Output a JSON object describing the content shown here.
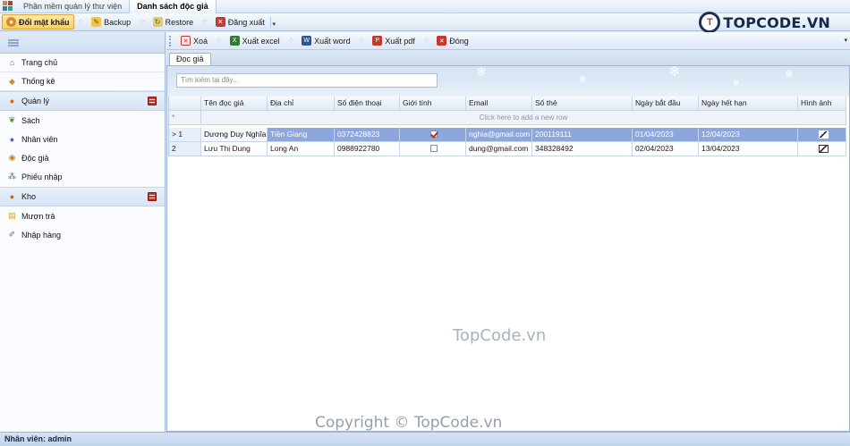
{
  "titlebar": {
    "tabs": [
      {
        "label": "Phần mềm quản lý thư viện",
        "active": false
      },
      {
        "label": "Danh sách độc giả",
        "active": true
      }
    ]
  },
  "toolbar": {
    "items": [
      {
        "label": "Đổi mật khẩu",
        "icon": "key-user-icon",
        "pressed": true
      },
      {
        "label": "Backup",
        "icon": "backup-icon"
      },
      {
        "label": "Restore",
        "icon": "restore-icon"
      },
      {
        "label": "Đăng xuất",
        "icon": "logout-icon"
      }
    ]
  },
  "logo": {
    "mark": "T",
    "text": "TOPCODE.VN"
  },
  "sidebar": {
    "items": [
      {
        "label": "Trang chủ",
        "icon": "home-icon",
        "group": false
      },
      {
        "label": "Thống kê",
        "icon": "chart-icon",
        "group": false
      },
      {
        "label": "Quản lý",
        "icon": "manage-icon",
        "group": true
      },
      {
        "label": "Sách",
        "icon": "book-icon",
        "group": false
      },
      {
        "label": "Nhân viên",
        "icon": "employee-icon",
        "group": false
      },
      {
        "label": "Độc giả",
        "icon": "reader-icon",
        "group": false
      },
      {
        "label": "Phiếu nhập",
        "icon": "receipt-icon",
        "group": false
      },
      {
        "label": "Kho",
        "icon": "warehouse-icon",
        "group": true
      },
      {
        "label": "Mượn trả",
        "icon": "borrow-icon",
        "group": false
      },
      {
        "label": "Nhập hàng",
        "icon": "import-icon",
        "group": false
      }
    ]
  },
  "content_toolbar": {
    "items": [
      {
        "label": "Xoá",
        "icon": "delete-icon"
      },
      {
        "label": "Xuất excel",
        "icon": "excel-icon"
      },
      {
        "label": "Xuất word",
        "icon": "word-icon"
      },
      {
        "label": "Xuất pdf",
        "icon": "pdf-icon"
      },
      {
        "label": "Đóng",
        "icon": "close-icon"
      }
    ]
  },
  "tab": {
    "label": "Đọc giả"
  },
  "search": {
    "placeholder": "Tìm kiếm tại đây..."
  },
  "grid": {
    "columns": [
      "Tên đọc giả",
      "Địa chỉ",
      "Số điện thoại",
      "Giới tính",
      "Email",
      "Số thẻ",
      "Ngày bắt đầu",
      "Ngày hết hạn",
      "Hình ảnh"
    ],
    "new_row_text": "Click here to add a new row",
    "new_row_marker": "*",
    "rows": [
      {
        "indicator": "> 1",
        "name": "Dương Duy Nghĩa",
        "address": "Tiền Giang",
        "phone": "0372428823",
        "gender_checked": true,
        "email": "nghia@gmail.com",
        "card": "200119111",
        "start": "01/04/2023",
        "end": "12/04/2023",
        "selected": true
      },
      {
        "indicator": "2",
        "name": "Lưu Thị Dung",
        "address": "Long An",
        "phone": "0988922780",
        "gender_checked": false,
        "email": "dung@gmail.com",
        "card": "348328492",
        "start": "02/04/2023",
        "end": "13/04/2023",
        "selected": false
      }
    ]
  },
  "watermark": "TopCode.vn",
  "copyright": "Copyright © TopCode.vn",
  "statusbar": {
    "text": "Nhân viên: admin"
  },
  "colors": {
    "accent": "#8ea6de",
    "pressed": "#f7cf6a",
    "logo": "#16294a"
  }
}
